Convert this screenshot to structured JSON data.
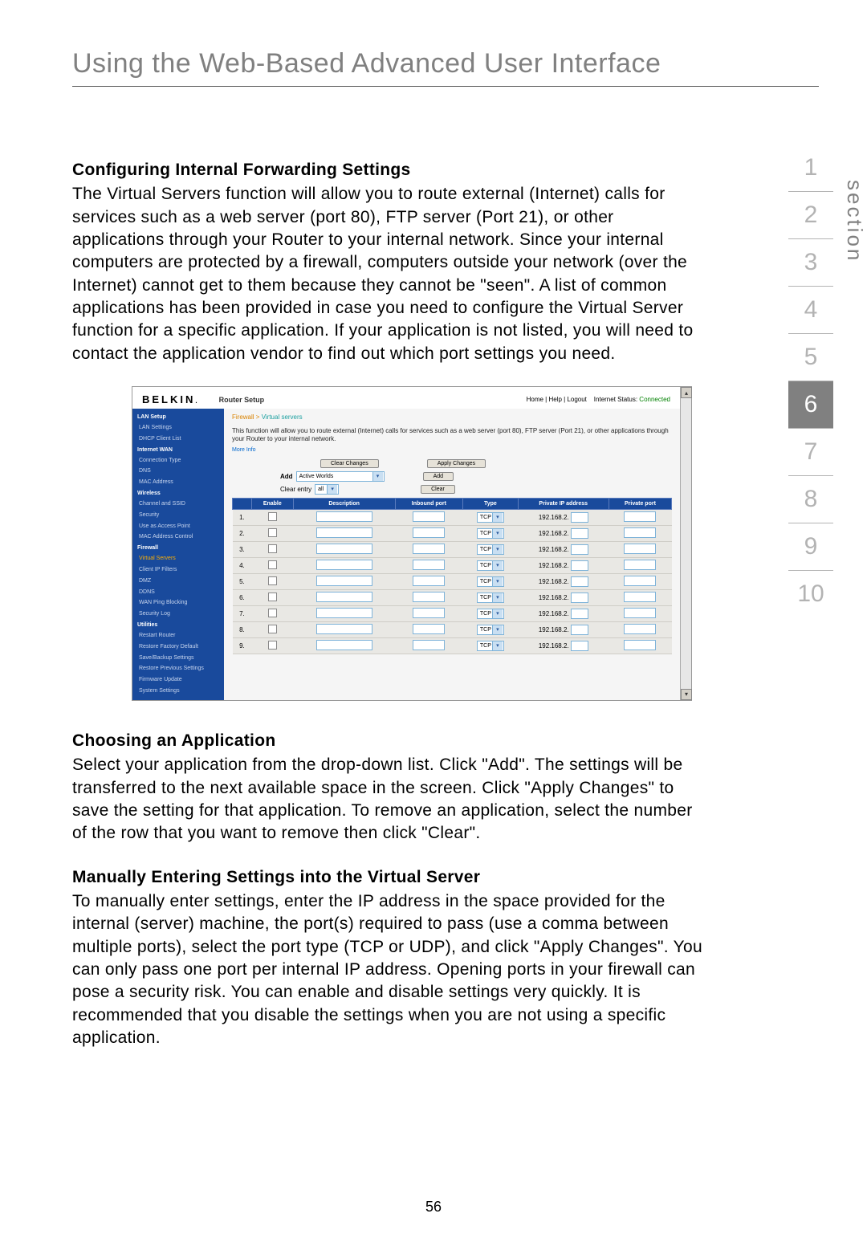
{
  "page_title": "Using the Web-Based Advanced User Interface",
  "page_number": "56",
  "section_word": "section",
  "tabs": [
    "1",
    "2",
    "3",
    "4",
    "5",
    "6",
    "7",
    "8",
    "9",
    "10"
  ],
  "active_tab_index": 5,
  "s1": {
    "heading": "Configuring Internal Forwarding Settings",
    "body": "The Virtual Servers function will allow you to route external (Internet) calls for services such as a web server (port 80), FTP server (Port 21), or other applications through your Router to your internal network. Since your internal computers are protected by a firewall, computers outside your network (over the Internet) cannot get to them because they cannot be \"seen\". A list of common applications has been provided in case you need to configure the Virtual Server function for a specific application. If your application is not listed, you will need to contact the application vendor to find out which port settings you need."
  },
  "s2": {
    "heading": "Choosing an Application",
    "body": "Select your application from the drop-down list. Click \"Add\". The settings will be transferred to the next available space in the screen. Click \"Apply Changes\" to save the setting for that application. To remove an application, select the number of the row that you want to remove then click \"Clear\"."
  },
  "s3": {
    "heading": "Manually Entering Settings into the Virtual Server",
    "body": "To manually enter settings, enter the IP address in the space provided for the internal (server) machine, the port(s) required to pass (use a comma between multiple ports), select the port type (TCP or UDP), and click \"Apply Changes\". You can only pass one port per internal IP address. Opening ports in your firewall can pose a security risk. You can enable and disable settings very quickly. It is recommended that you disable the settings when you are not using a specific application."
  },
  "router": {
    "brand": "BELKIN",
    "brand_dot": ".",
    "setup_label": "Router Setup",
    "header_links": "Home | Help | Logout",
    "status_label": "Internet Status:",
    "status_value": "Connected",
    "sidebar": [
      {
        "t": "cat",
        "label": "LAN Setup"
      },
      {
        "t": "item",
        "label": "LAN Settings"
      },
      {
        "t": "item",
        "label": "DHCP Client List"
      },
      {
        "t": "cat",
        "label": "Internet WAN"
      },
      {
        "t": "item",
        "label": "Connection Type"
      },
      {
        "t": "item",
        "label": "DNS"
      },
      {
        "t": "item",
        "label": "MAC Address"
      },
      {
        "t": "cat",
        "label": "Wireless"
      },
      {
        "t": "item",
        "label": "Channel and SSID"
      },
      {
        "t": "item",
        "label": "Security"
      },
      {
        "t": "item",
        "label": "Use as Access Point"
      },
      {
        "t": "item",
        "label": "MAC Address Control"
      },
      {
        "t": "cat",
        "label": "Firewall"
      },
      {
        "t": "item",
        "label": "Virtual Servers",
        "cls": "orange"
      },
      {
        "t": "item",
        "label": "Client IP Filters"
      },
      {
        "t": "item",
        "label": "DMZ"
      },
      {
        "t": "item",
        "label": "DDNS"
      },
      {
        "t": "item",
        "label": "WAN Ping Blocking"
      },
      {
        "t": "item",
        "label": "Security Log"
      },
      {
        "t": "cat",
        "label": "Utilities"
      },
      {
        "t": "item",
        "label": "Restart Router"
      },
      {
        "t": "item",
        "label": "Restore Factory Default"
      },
      {
        "t": "item",
        "label": "Save/Backup Settings"
      },
      {
        "t": "item",
        "label": "Restore Previous Settings"
      },
      {
        "t": "item",
        "label": "Firmware Update"
      },
      {
        "t": "item",
        "label": "System Settings"
      }
    ],
    "bc1": "Firewall >",
    "bc2": "Virtual servers",
    "desc": "This function will allow you to route external (Internet) calls for services such as a web server (port 80), FTP server (Port 21), or other applications through your Router to your internal network.",
    "more_info": "More Info",
    "btn_clear_changes": "Clear Changes",
    "btn_apply_changes": "Apply Changes",
    "add_label": "Add",
    "add_select": "Active Worlds",
    "btn_add": "Add",
    "clear_label": "Clear entry",
    "clear_select": "all",
    "btn_clear": "Clear",
    "th": [
      "",
      "Enable",
      "Description",
      "Inbound port",
      "Type",
      "Private IP address",
      "Private port"
    ],
    "rows_numbers": [
      "1.",
      "2.",
      "3.",
      "4.",
      "5.",
      "6.",
      "7.",
      "8.",
      "9."
    ],
    "type_value": "TCP",
    "ip_prefix": "192.168.2."
  }
}
